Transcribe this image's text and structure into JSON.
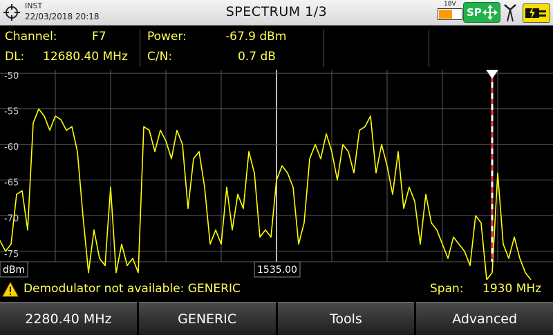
{
  "header": {
    "mode": "INST",
    "datetime": "22/03/2018 20:18",
    "title": "SPECTRUM 1/3",
    "battery_voltage": "18V",
    "sp_label": "SP",
    "icons": [
      "crosshair-icon",
      "battery-icon",
      "sp-move-icon",
      "antenna-icon",
      "power-plug-icon"
    ],
    "battery_level": 0.55
  },
  "info": {
    "channel_label": "Channel:",
    "channel_value": "F7",
    "dl_label": "DL:",
    "dl_value": "12680.40 MHz",
    "power_label": "Power:",
    "power_value": "-67.9 dBm",
    "cn_label": "C/N:",
    "cn_value": "0.7 dB"
  },
  "chart_data": {
    "type": "line",
    "unit_label": "dBm",
    "center_label": "1535.00",
    "y_ticks": [
      "-50",
      "-55",
      "-60",
      "-65",
      "-70",
      "-75"
    ],
    "ylim": [
      -79,
      -49.5
    ],
    "xlim": [
      0,
      100
    ],
    "grid": true,
    "marker_x": 89,
    "series": [
      {
        "color": "#ffff00",
        "x": [
          0,
          1,
          2,
          3,
          4,
          5,
          6,
          7,
          8,
          9,
          10,
          11,
          12,
          13,
          14,
          15,
          16,
          17,
          18,
          19,
          20,
          21,
          22,
          23,
          24,
          25,
          26,
          27,
          28,
          29,
          30,
          31,
          32,
          33,
          34,
          35,
          36,
          37,
          38,
          39,
          40,
          41,
          42,
          43,
          44,
          45,
          46,
          47,
          48,
          49,
          50,
          51,
          52,
          53,
          54,
          55,
          56,
          57,
          58,
          59,
          60,
          61,
          62,
          63,
          64,
          65,
          66,
          67,
          68,
          69,
          70,
          71,
          72,
          73,
          74,
          75,
          76,
          77,
          78,
          79,
          80,
          81,
          82,
          83,
          84,
          85,
          86,
          87,
          88,
          89,
          90,
          91,
          92,
          93,
          94,
          95,
          96
        ],
        "y": [
          -73.5,
          -75,
          -74,
          -67,
          -66.5,
          -72,
          -57,
          -55,
          -56,
          -58,
          -56,
          -56.5,
          -58,
          -57.5,
          -61,
          -70,
          -78,
          -72,
          -76,
          -77,
          -66,
          -78,
          -74,
          -77,
          -76,
          -78,
          -57.5,
          -58,
          -61,
          -58,
          -59.5,
          -62,
          -58,
          -60,
          -69,
          -62,
          -61,
          -66,
          -74,
          -72,
          -74,
          -66,
          -72,
          -67,
          -69,
          -61,
          -64,
          -73,
          -72,
          -73,
          -65,
          -63,
          -64,
          -66,
          -74,
          -71,
          -62,
          -60,
          -62,
          -58.5,
          -61,
          -65,
          -60,
          -61,
          -64,
          -58,
          -57.5,
          -56,
          -64,
          -60,
          -63,
          -67,
          -61,
          -69,
          -66,
          -68,
          -74,
          -67,
          -71,
          -72,
          -74,
          -76,
          -73,
          -74,
          -75,
          -77,
          -70,
          -71,
          -79,
          -78,
          -64,
          -74,
          -76,
          -73,
          -76,
          -78,
          -79
        ]
      }
    ]
  },
  "status": {
    "warning": "Demodulator not available: GENERIC",
    "span_label": "Span:",
    "span_value": "1930 MHz"
  },
  "softkeys": [
    "2280.40 MHz",
    "GENERIC",
    "Tools",
    "Advanced"
  ]
}
